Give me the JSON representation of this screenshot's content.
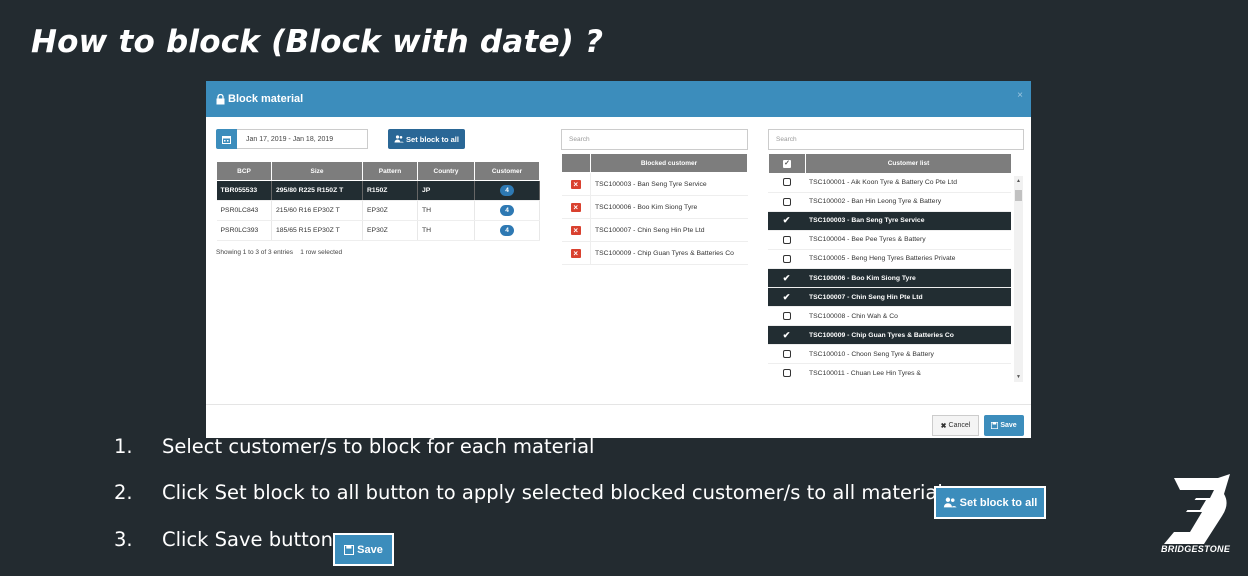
{
  "slide": {
    "title": "How to block (Block with date) ?",
    "brand": "BRIDGESTONE"
  },
  "modal": {
    "title": "Block material",
    "close": "×",
    "date_range": "Jan 17, 2019 - Jan 18, 2019",
    "set_block_label": "Set block to all",
    "materials": {
      "headers": [
        "BCP",
        "Size",
        "Pattern",
        "Country",
        "Customer"
      ],
      "rows": [
        {
          "bcp": "TBR055533",
          "size": "295/80 R225 R150Z T",
          "pattern": "R150Z",
          "country": "JP",
          "customer": "4"
        },
        {
          "bcp": "PSR0LC843",
          "size": "215/60 R16 EP30Z T",
          "pattern": "EP30Z",
          "country": "TH",
          "customer": "4"
        },
        {
          "bcp": "PSR0LC393",
          "size": "185/65 R15 EP30Z T",
          "pattern": "EP30Z",
          "country": "TH",
          "customer": "4"
        }
      ],
      "showing": "Showing 1 to 3 of 3 entries",
      "selected": "1 row selected"
    },
    "blocked": {
      "search_placeholder": "Search",
      "header": "Blocked customer",
      "rows": [
        "TSC100003 - Ban Seng Tyre Service",
        "TSC100006 - Boo Kim Siong Tyre",
        "TSC100007 - Chin Seng Hin Pte Ltd",
        "TSC100009 - Chip Guan Tyres & Batteries Co"
      ]
    },
    "customers": {
      "search_placeholder": "Search",
      "header": "Customer list",
      "rows": [
        {
          "name": "TSC100001 - Aik Koon Tyre & Battery Co Pte Ltd",
          "checked": false
        },
        {
          "name": "TSC100002 - Ban Hin Leong Tyre & Battery",
          "checked": false
        },
        {
          "name": "TSC100003 - Ban Seng Tyre Service",
          "checked": true
        },
        {
          "name": "TSC100004 - Bee Pee Tyres & Battery",
          "checked": false
        },
        {
          "name": "TSC100005 - Beng Heng Tyres Batteries Private",
          "checked": false
        },
        {
          "name": "TSC100006 - Boo Kim Siong Tyre",
          "checked": true
        },
        {
          "name": "TSC100007 - Chin Seng Hin Pte Ltd",
          "checked": true
        },
        {
          "name": "TSC100008 - Chin Wah & Co",
          "checked": false
        },
        {
          "name": "TSC100009 - Chip Guan Tyres & Batteries Co",
          "checked": true
        },
        {
          "name": "TSC100010 - Choon Seng Tyre & Battery",
          "checked": false
        },
        {
          "name": "TSC100011 - Chuan Lee Hin Tyres &",
          "checked": false
        }
      ]
    },
    "cancel_label": "Cancel",
    "save_label": "Save"
  },
  "steps": [
    {
      "num": "1.",
      "text": "Select customer/s to block for each material"
    },
    {
      "num": "2.",
      "text": "Click Set block to all button to apply selected blocked customer/s to all material"
    },
    {
      "num": "3.",
      "text": "Click Save button"
    }
  ],
  "inline_buttons": {
    "set_block": "Set block to all",
    "save": "Save"
  },
  "colors": {
    "background": "#232b30",
    "header_blue": "#3c8dbc",
    "selected_row": "#222d32",
    "remove_red": "#d9412f"
  }
}
